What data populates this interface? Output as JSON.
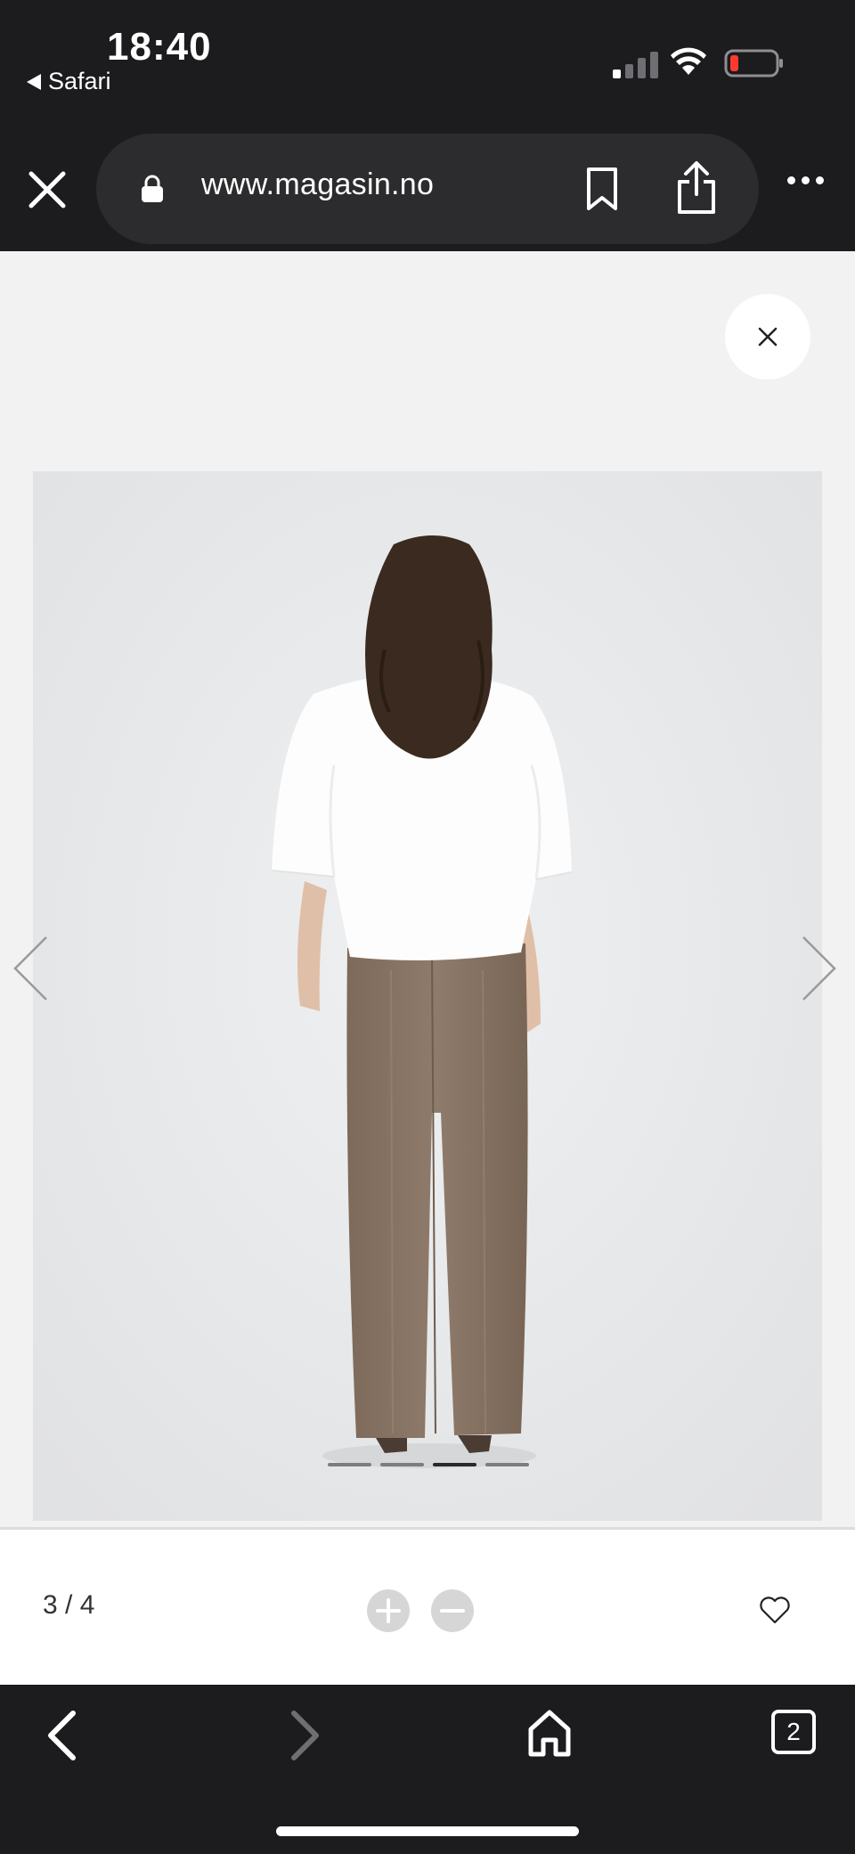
{
  "status_bar": {
    "time": "18:40",
    "back_app": "Safari",
    "icons": [
      "signal-icon",
      "wifi-icon",
      "battery-low-icon"
    ]
  },
  "browser": {
    "url": "www.magasin.no",
    "buttons": [
      "close-icon",
      "lock-icon",
      "bookmark-icon",
      "share-icon",
      "more-icon"
    ]
  },
  "gallery": {
    "counter": "3 / 4",
    "current_index": 3,
    "total": 4,
    "image_description_colors": {
      "shirt": "#ffffff",
      "trousers": "#8a7565",
      "hair": "#3b2a1f",
      "background": "#e8e9ea"
    }
  },
  "toolbar": {
    "tabs_count": "2",
    "icons": [
      "back-icon",
      "forward-icon",
      "home-icon",
      "tabs-icon"
    ]
  },
  "colors": {
    "chrome": "#1c1c1e",
    "pill": "#2c2c2e",
    "content_bg": "#f2f2f2",
    "accent_dark": "#2a2a2a"
  }
}
